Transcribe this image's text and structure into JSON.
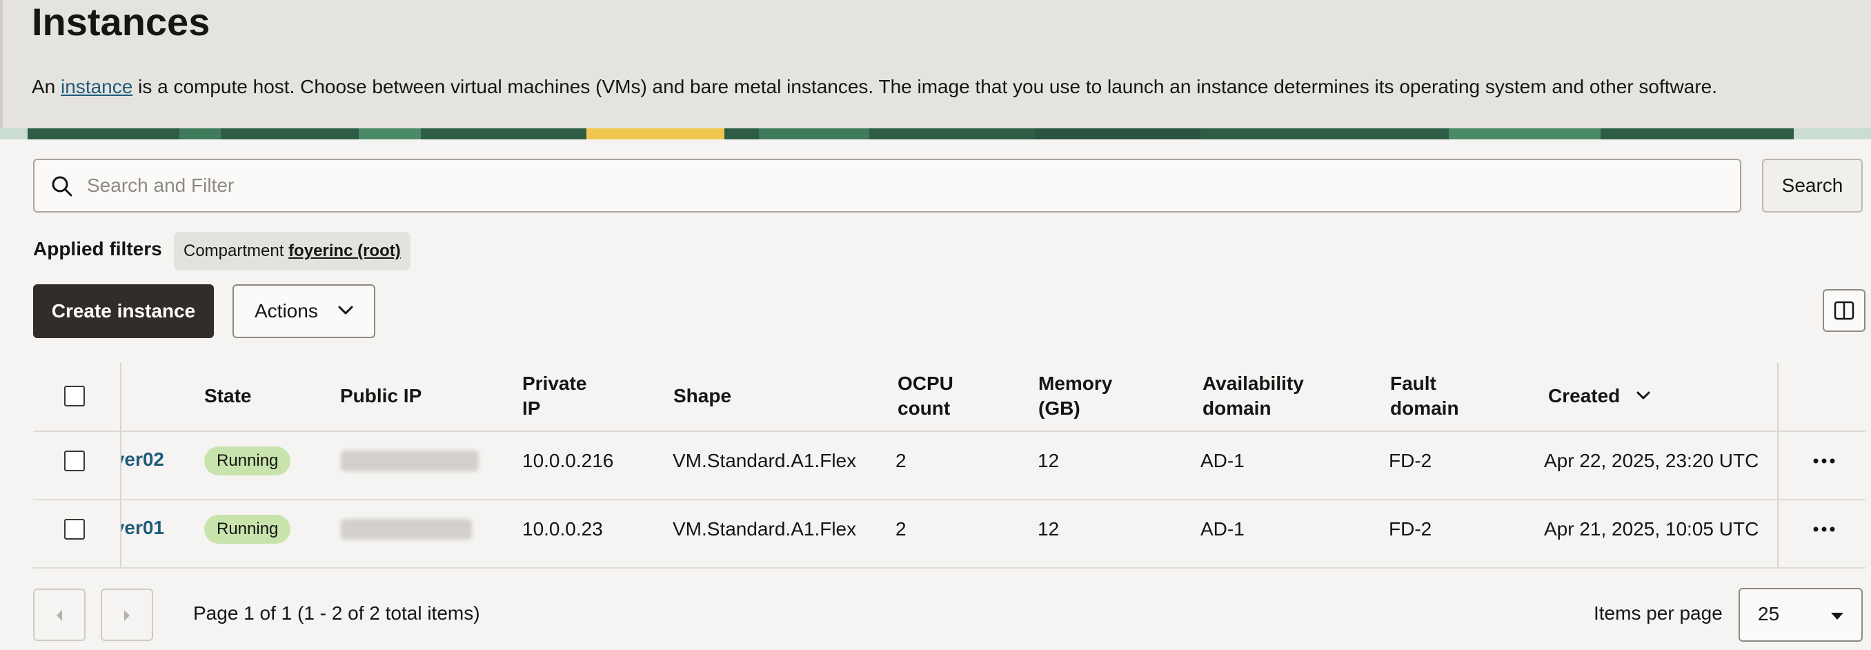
{
  "page": {
    "title": "Instances",
    "description_prefix": "An ",
    "description_link": "instance",
    "description_suffix": " is a compute host. Choose between virtual machines (VMs) and bare metal instances. The image that you use to launch an instance determines its operating system and other software."
  },
  "search": {
    "placeholder": "Search and Filter",
    "button_label": "Search"
  },
  "filters": {
    "label": "Applied filters",
    "chip_key": "Compartment",
    "chip_value": "foyerinc (root)"
  },
  "toolbar": {
    "create_label": "Create instance",
    "actions_label": "Actions"
  },
  "table": {
    "headers": {
      "state": "State",
      "public_ip": "Public IP",
      "private_ip_1": "Private",
      "private_ip_2": "IP",
      "shape": "Shape",
      "ocpu_1": "OCPU",
      "ocpu_2": "count",
      "memory_1": "Memory",
      "memory_2": "(GB)",
      "ad_1": "Availability",
      "ad_2": "domain",
      "fd_1": "Fault",
      "fd_2": "domain",
      "created": "Created"
    },
    "rows": [
      {
        "name": "ver02",
        "state": "Running",
        "private_ip": "10.0.0.216",
        "shape": "VM.Standard.A1.Flex",
        "ocpu": "2",
        "memory": "12",
        "ad": "AD-1",
        "fd": "FD-2",
        "created": "Apr 22, 2025, 23:20 UTC"
      },
      {
        "name": "ver01",
        "state": "Running",
        "private_ip": "10.0.0.23",
        "shape": "VM.Standard.A1.Flex",
        "ocpu": "2",
        "memory": "12",
        "ad": "AD-1",
        "fd": "FD-2",
        "created": "Apr 21, 2025, 10:05 UTC"
      }
    ]
  },
  "pagination": {
    "summary": "Page 1 of 1 (1 - 2 of 2 total items)",
    "items_per_page_label": "Items per page",
    "items_per_page_value": "25"
  },
  "colors": {
    "link": "#1f5c7a",
    "primary_button": "#312d2a",
    "running_badge": "#c8e3ac",
    "header_band": "#e5e3df"
  },
  "icons": {
    "search": "search-icon",
    "actions_chevron": "chevron-down-icon",
    "columns": "columns-icon",
    "sort": "sort-descending-icon",
    "row_menu": "more-horizontal-icon",
    "prev": "chevron-left-icon",
    "next": "chevron-right-icon",
    "select": "caret-down-icon"
  }
}
